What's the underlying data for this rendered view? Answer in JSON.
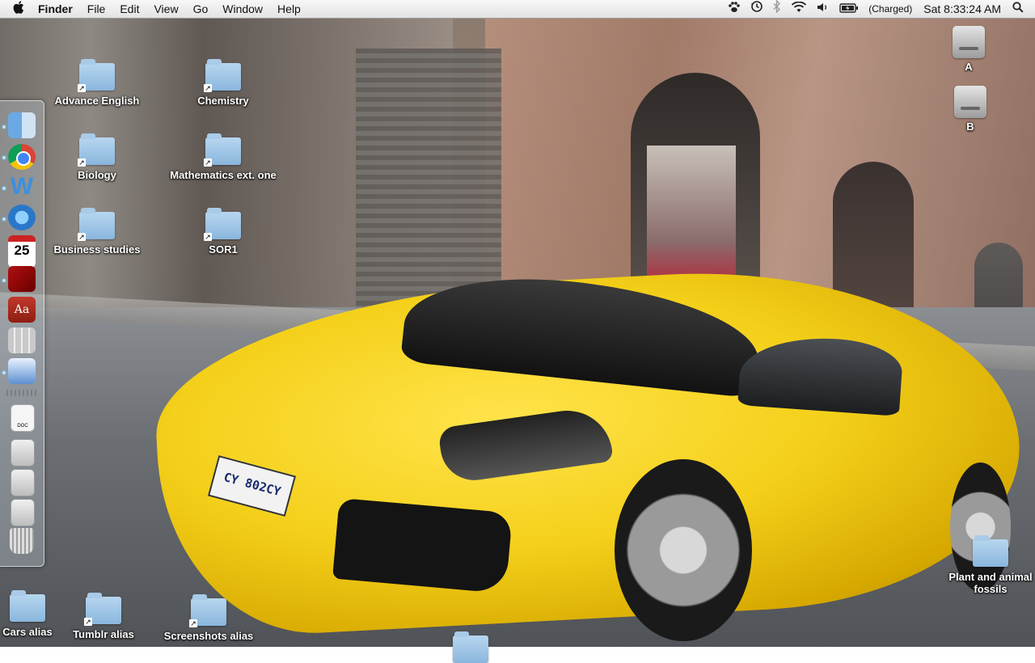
{
  "menubar": {
    "apple": "",
    "app_name": "Finder",
    "menus": [
      "File",
      "Edit",
      "View",
      "Go",
      "Window",
      "Help"
    ],
    "battery_status": "(Charged)",
    "clock": "Sat 8:33:24 AM"
  },
  "desktop_icons": [
    {
      "label": "Advance English",
      "kind": "folder",
      "alias": true
    },
    {
      "label": "Chemistry",
      "kind": "folder",
      "alias": true
    },
    {
      "label": "Biology",
      "kind": "folder",
      "alias": true
    },
    {
      "label": "Mathematics ext. one",
      "kind": "folder",
      "alias": true
    },
    {
      "label": "Business studies",
      "kind": "folder",
      "alias": true
    },
    {
      "label": "SOR1",
      "kind": "folder",
      "alias": true
    },
    {
      "label": "A",
      "kind": "drive",
      "alias": false
    },
    {
      "label": "B",
      "kind": "drive",
      "alias": false
    },
    {
      "label": "Plant and animal fossils",
      "kind": "folder",
      "alias": false
    },
    {
      "label": "Cars alias",
      "kind": "folder",
      "alias": false
    },
    {
      "label": "Tumblr alias",
      "kind": "folder",
      "alias": true
    },
    {
      "label": "Screenshots alias",
      "kind": "folder",
      "alias": true
    }
  ],
  "dock": {
    "items": [
      {
        "icon": "finder-icon",
        "running": true
      },
      {
        "icon": "chrome-icon",
        "running": true
      },
      {
        "icon": "word-icon",
        "running": true
      },
      {
        "icon": "itunes-icon",
        "running": true
      },
      {
        "icon": "ical-icon",
        "running": false,
        "text": "25"
      },
      {
        "icon": "photo-booth-icon",
        "running": true
      },
      {
        "icon": "dictionary-icon",
        "running": false,
        "text": "Aa"
      },
      {
        "icon": "calculator-icon",
        "running": false
      },
      {
        "icon": "preview-icon",
        "running": true
      },
      {
        "icon": "doc-file-icon",
        "running": false,
        "text": "DOC"
      },
      {
        "icon": "document-stack-icon",
        "running": false
      },
      {
        "icon": "document-stack-icon",
        "running": false
      },
      {
        "icon": "document-stack-icon",
        "running": false
      },
      {
        "icon": "trash-icon",
        "running": false
      }
    ]
  },
  "wallpaper": {
    "license_plate": "CY 802CY",
    "accent": "#f4d01a"
  }
}
